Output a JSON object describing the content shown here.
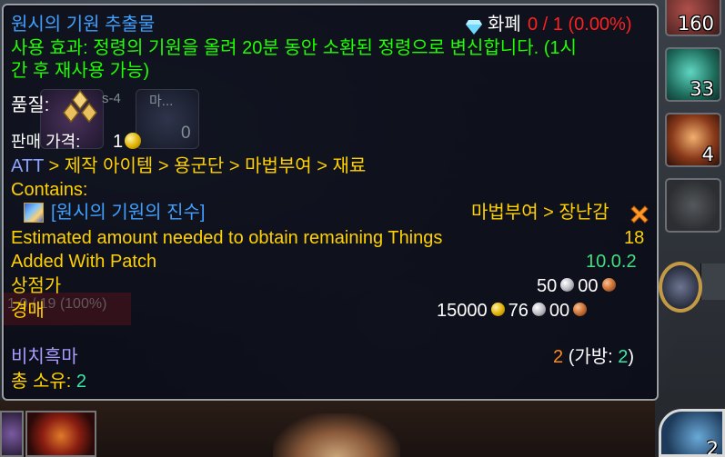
{
  "tooltip": {
    "title": "원시의 기원 추출물",
    "currency_label": "화폐",
    "currency_value": "0 / 1 (0.00%)",
    "use_effect": "사용 효과: 정령의 기원을 올려 20분 동안 소환된 정령으로 변신합니다. (1시",
    "use_effect_cont": "간 후 재사용 가능)",
    "quality_label": "품질:",
    "sell_price_label": "판매 가격:",
    "sell_price_value": "1",
    "att_path_prefix": "ATT",
    "att_path_rest": " > 제작 아이템 > 용군단 > 마법부여 > 재료",
    "contains_label": "Contains:",
    "contains_item": "[원시의 기원의 진수]",
    "contains_category": "마법부여 > 장난감",
    "estimated_label": "Estimated amount needed to obtain remaining Things",
    "estimated_value": "18",
    "added_patch_label": "Added With Patch",
    "added_patch_value": "10.0.2",
    "vendor_label": "상점가",
    "vendor_silver": "50",
    "vendor_copper": "00",
    "auction_label": "경매",
    "auction_gold": "15000",
    "auction_silver": "76",
    "auction_copper": "00",
    "owner_label": "비치흑마",
    "owner_count": "2",
    "owner_bank_prefix": "(가방: ",
    "owner_bank_value": "2",
    "owner_bank_suffix": ")",
    "total_label": "총 소유: ",
    "total_value": "2",
    "ghost_text_1": "s-4",
    "ghost_text_2": "마...",
    "ghost_text_3": "0",
    "ghost_bg_text": "1 0 / 19 (100%)"
  },
  "action_bar": {
    "slot_1_count": "160",
    "slot_2_count": "33",
    "slot_3_count": "4",
    "corner_count": "2"
  },
  "colors": {
    "title": "#3fa0ff",
    "use_effect": "#1eff00",
    "label_gold": "#ffd100",
    "att": "#8aa4ff",
    "patch": "#40e080",
    "owner": "#a89cff",
    "count": "#ff8a1a",
    "bank": "#3ce8a8",
    "currency_red": "#ff2020"
  },
  "icons": {
    "quality": "gold-diamond-quality-icon",
    "sell_coin": "gold-coin-icon",
    "currency": "blue-diamond-icon",
    "contains_item": "primal-essence-icon",
    "uncollected": "orange-x-icon"
  }
}
